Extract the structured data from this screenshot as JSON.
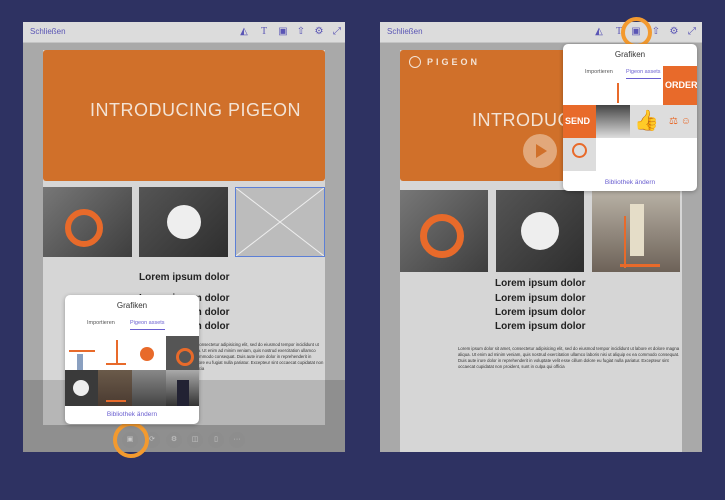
{
  "colors": {
    "background": "#2e3262",
    "accent": "#6a5fd0",
    "hero": "#d0702a",
    "highlight": "#f39a2f"
  },
  "toolbar": {
    "close_label": "Schließen",
    "icons": [
      "shape-icon",
      "text-icon",
      "image-icon",
      "share-icon",
      "settings-icon",
      "expand-icon"
    ],
    "text_glyph": "T"
  },
  "hero": {
    "title": "INTRODUCING PIGEON",
    "title_partial": "INTRODUCING",
    "brand": "PIGEON"
  },
  "lorem_heading": "Lorem ipsum dolor",
  "body_text": "Lorem ipsum dolor sit amet, consectetur adipisicing elit, sed do eiusmod tempor incididunt ut labore et dolore magna aliqua. Ut enim ad minim veniam, quis nostrud exercitation ullamco laboris nisi ut aliquip ex ea commodo consequat. Duis aute irure dolor in reprehenderit in voluptate velit esse cillum dolore eu fugiat nulla pariatur. Excepteur sint occaecat cupidatat non proident, sunt in culpa qui officia",
  "popover": {
    "title": "Grafiken",
    "tabs": [
      {
        "label": "Importieren",
        "active": false
      },
      {
        "label": "Pigeon assets",
        "active": true
      }
    ],
    "footer": "Bibliothek ändern",
    "asset_labels": {
      "send": "SEND",
      "order": "ORDER"
    }
  },
  "bottom_toolbar": {
    "icons": [
      "image-icon",
      "link-icon",
      "settings-icon",
      "layers-icon",
      "trash-icon",
      "more-icon"
    ],
    "more_glyph": "···"
  }
}
